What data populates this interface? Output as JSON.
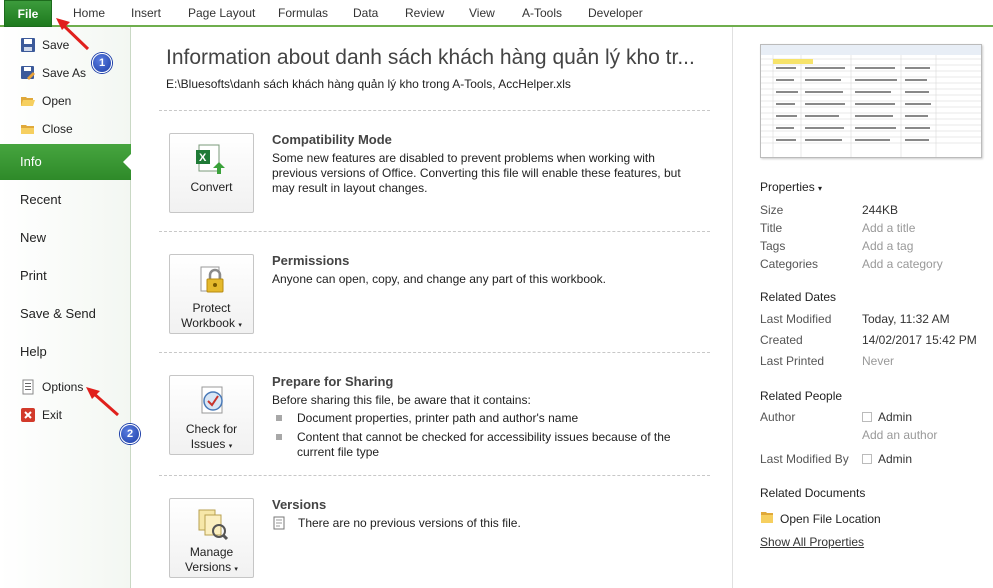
{
  "ribbon": {
    "file": "File",
    "tabs": [
      "Home",
      "Insert",
      "Page Layout",
      "Formulas",
      "Data",
      "Review",
      "View",
      "A-Tools",
      "Developer"
    ]
  },
  "nav": {
    "save": "Save",
    "save_as": "Save As",
    "open": "Open",
    "close": "Close",
    "info": "Info",
    "recent": "Recent",
    "new": "New",
    "print": "Print",
    "save_send": "Save & Send",
    "help": "Help",
    "options": "Options",
    "exit": "Exit"
  },
  "main": {
    "title": "Information about danh sách khách hàng quản lý kho tr...",
    "path": "E:\\Bluesofts\\danh sách khách hàng quản lý kho trong A-Tools, AccHelper.xls",
    "compat": {
      "button": "Convert",
      "heading": "Compatibility Mode",
      "text": "Some new features are disabled to prevent problems when working with previous versions of Office. Converting this file will enable these features, but may result in layout changes."
    },
    "permissions": {
      "button_line1": "Protect",
      "button_line2": "Workbook",
      "heading": "Permissions",
      "text": "Anyone can open, copy, and change any part of this workbook."
    },
    "sharing": {
      "button_line1": "Check for",
      "button_line2": "Issues",
      "heading": "Prepare for Sharing",
      "text": "Before sharing this file, be aware that it contains:",
      "bullet1": "Document properties, printer path and author's name",
      "bullet2": "Content that cannot be checked for accessibility issues because of the current file type"
    },
    "versions": {
      "button_line1": "Manage",
      "button_line2": "Versions",
      "heading": "Versions",
      "text": "There are no previous versions of this file."
    }
  },
  "props": {
    "header": "Properties",
    "size_k": "Size",
    "size_v": "244KB",
    "title_k": "Title",
    "title_v": "Add a title",
    "tags_k": "Tags",
    "tags_v": "Add a tag",
    "cat_k": "Categories",
    "cat_v": "Add a category",
    "dates_h": "Related Dates",
    "mod_k": "Last Modified",
    "mod_v": "Today, 11:32 AM",
    "created_k": "Created",
    "created_v": "14/02/2017 15:42 PM",
    "printed_k": "Last Printed",
    "printed_v": "Never",
    "people_h": "Related People",
    "author_k": "Author",
    "author_v": "Admin",
    "add_author": "Add an author",
    "modby_k": "Last Modified By",
    "modby_v": "Admin",
    "docs_h": "Related Documents",
    "open_loc": "Open File Location",
    "show_all": "Show All Properties"
  },
  "annotations": {
    "badge1": "1",
    "badge2": "2"
  },
  "colors": {
    "accent": "#2e8a29",
    "arrow": "#e0201c",
    "badge": "#1c3ea8"
  }
}
